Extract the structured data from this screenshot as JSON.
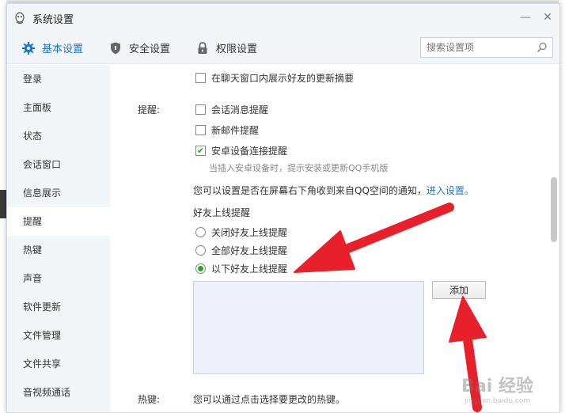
{
  "window": {
    "title": "系统设置",
    "minimize": "—",
    "close": "✕"
  },
  "tabs": [
    {
      "label": "基本设置",
      "icon": "gear-icon",
      "active": true
    },
    {
      "label": "安全设置",
      "icon": "shield-icon",
      "active": false
    },
    {
      "label": "权限设置",
      "icon": "lock-icon",
      "active": false
    }
  ],
  "search": {
    "placeholder": "搜索设置项"
  },
  "sidebar": {
    "items": [
      {
        "label": "登录"
      },
      {
        "label": "主面板"
      },
      {
        "label": "状态"
      },
      {
        "label": "会话窗口"
      },
      {
        "label": "信息展示"
      },
      {
        "label": "提醒"
      },
      {
        "label": "热键"
      },
      {
        "label": "声音"
      },
      {
        "label": "软件更新"
      },
      {
        "label": "文件管理"
      },
      {
        "label": "文件共享"
      },
      {
        "label": "音视频通话"
      }
    ],
    "active_index": 5
  },
  "content": {
    "show_friend_updates": {
      "label": "在聊天窗口内展示好友的更新摘要",
      "checked": false
    },
    "reminder_label": "提醒:",
    "session_msg": {
      "label": "会话消息提醒",
      "checked": false
    },
    "new_mail": {
      "label": "新邮件提醒",
      "checked": false
    },
    "android": {
      "label": "安卓设备连接提醒",
      "checked": true
    },
    "android_hint": "当插入安卓设备时，提示安装或更新QQ手机版",
    "qzone_text": "您可以设置是否在屏幕右下角收到来自QQ空间的通知，",
    "qzone_link": "进入设置。",
    "online_title": "好友上线提醒",
    "radio_off": "关闭好友上线提醒",
    "radio_all": "全部好友上线提醒",
    "radio_selected": "以下好友上线提醒",
    "selected_radio": "以下好友上线提醒",
    "add_button": "添加",
    "hotkey_label": "热键:",
    "hotkey_text": "您可以通过点击选择要更改的热键。"
  },
  "watermark": {
    "main": "Bai 经验",
    "sub": "jingyan.baidu.com"
  },
  "colors": {
    "accent": "#1872d4",
    "arrow": "#e8202a",
    "check": "#2aa52a"
  }
}
